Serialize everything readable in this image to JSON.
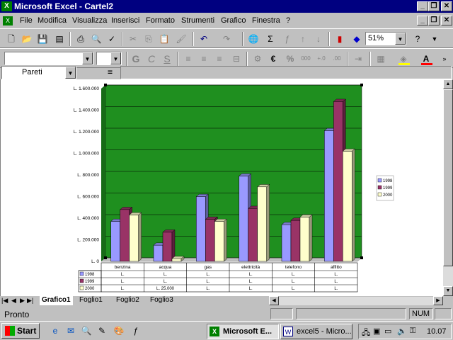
{
  "window": {
    "title": "Microsoft Excel - Cartel2"
  },
  "menu": [
    "File",
    "Modifica",
    "Visualizza",
    "Inserisci",
    "Formato",
    "Strumenti",
    "Grafico",
    "Finestra",
    "?"
  ],
  "toolbar": {
    "zoom": "51%"
  },
  "formatting": {
    "bold": "G",
    "italic": "C",
    "underline": "S",
    "currency": "€",
    "percent": "%"
  },
  "formula_bar": {
    "name_box": "Pareti",
    "equals": "="
  },
  "chart_data": {
    "type": "bar",
    "categories": [
      "benzina",
      "acqua",
      "gas",
      "elettricità",
      "telefono",
      "affitto"
    ],
    "series": [
      {
        "name": "1998",
        "values": [
          370000,
          150000,
          600000,
          790000,
          340000,
          1210000
        ]
      },
      {
        "name": "1999",
        "values": [
          480000,
          270000,
          390000,
          490000,
          380000,
          1480000
        ]
      },
      {
        "name": "2000",
        "values": [
          430000,
          25000,
          370000,
          690000,
          410000,
          1020000
        ]
      }
    ],
    "ylim": [
      0,
      1600000
    ],
    "y_ticks": [
      "L. 1.600.000",
      "L. 1.400.000",
      "L. 1.200.000",
      "L. 1.000.000",
      "L. 800.000",
      "L. 600.000",
      "L. 400.000",
      "L. 200.000",
      "L. 0"
    ],
    "grid": true,
    "legend": [
      "1998",
      "1999",
      "2000"
    ],
    "legend_position": "right",
    "table": [
      {
        "label": "1998",
        "cells": [
          "L.",
          "L.",
          "L.",
          "L.",
          "L.",
          "L."
        ]
      },
      {
        "label": "1999",
        "cells": [
          "L.",
          "L.",
          "L.",
          "L.",
          "L.",
          "L."
        ]
      },
      {
        "label": "2000",
        "cells": [
          "L.",
          "L. 25.000",
          "L.",
          "L.",
          "L.",
          "L."
        ]
      }
    ],
    "colors": {
      "1998": "#9999ff",
      "1999": "#993366",
      "2000": "#ffffcc",
      "plot_bg": "#1f8f1f",
      "chart_bg": "#ffffff"
    }
  },
  "sheet_tabs": [
    "Grafico1",
    "Foglio1",
    "Foglio2",
    "Foglio3"
  ],
  "active_tab": "Grafico1",
  "status": {
    "left": "Pronto",
    "num": "NUM"
  },
  "taskbar": {
    "start": "Start",
    "tasks": [
      "Microsoft E...",
      "excel5 - Micro..."
    ],
    "clock": "10.07"
  }
}
